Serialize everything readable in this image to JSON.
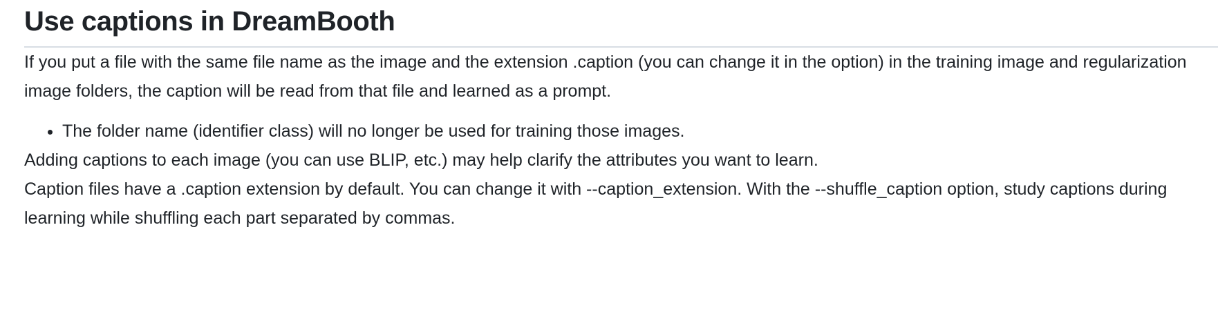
{
  "heading": "Use captions in DreamBooth",
  "paragraphs": {
    "intro": "If you put a file with the same file name as the image and the extension .caption (you can change it in the option) in the training image and regularization image folders, the caption will be read from that file and learned as a prompt.",
    "adding": "Adding captions to each image (you can use BLIP, etc.) may help clarify the attributes you want to learn.",
    "caption_files": "Caption files have a .caption extension by default. You can change it with --caption_extension. With the --shuffle_caption option, study captions during learning while shuffling each part separated by commas."
  },
  "bullets": [
    "The folder name (identifier class) will no longer be used for training those images."
  ]
}
